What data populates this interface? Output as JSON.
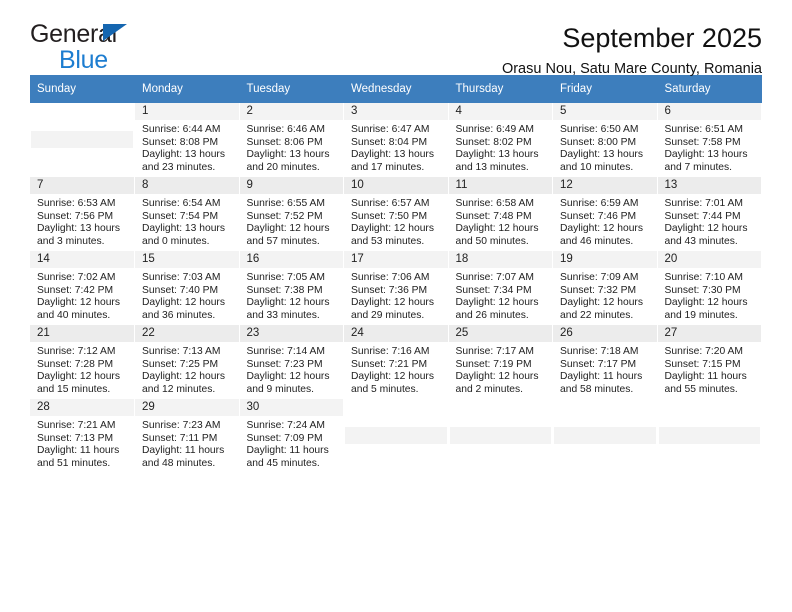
{
  "brand": {
    "name_top": "General",
    "name_bottom": "Blue",
    "accent_color": "#1d7dd0",
    "triangle_color": "#1566b0"
  },
  "header": {
    "title": "September 2025",
    "location": "Orasu Nou, Satu Mare County, Romania"
  },
  "calendar": {
    "header_bg": "#3d7ebd",
    "daynum_bg": "#f3f3f3",
    "daynum_bg_alt": "#ececec",
    "weekday_headers": [
      "Sunday",
      "Monday",
      "Tuesday",
      "Wednesday",
      "Thursday",
      "Friday",
      "Saturday"
    ],
    "labels": {
      "sunrise": "Sunrise:",
      "sunset": "Sunset:",
      "daylight": "Daylight:"
    },
    "weeks": [
      [
        {
          "empty": true
        },
        {
          "day": "1",
          "sunrise": "Sunrise: 6:44 AM",
          "sunset": "Sunset: 8:08 PM",
          "daylight": "Daylight: 13 hours and 23 minutes."
        },
        {
          "day": "2",
          "sunrise": "Sunrise: 6:46 AM",
          "sunset": "Sunset: 8:06 PM",
          "daylight": "Daylight: 13 hours and 20 minutes."
        },
        {
          "day": "3",
          "sunrise": "Sunrise: 6:47 AM",
          "sunset": "Sunset: 8:04 PM",
          "daylight": "Daylight: 13 hours and 17 minutes."
        },
        {
          "day": "4",
          "sunrise": "Sunrise: 6:49 AM",
          "sunset": "Sunset: 8:02 PM",
          "daylight": "Daylight: 13 hours and 13 minutes."
        },
        {
          "day": "5",
          "sunrise": "Sunrise: 6:50 AM",
          "sunset": "Sunset: 8:00 PM",
          "daylight": "Daylight: 13 hours and 10 minutes."
        },
        {
          "day": "6",
          "sunrise": "Sunrise: 6:51 AM",
          "sunset": "Sunset: 7:58 PM",
          "daylight": "Daylight: 13 hours and 7 minutes."
        }
      ],
      [
        {
          "day": "7",
          "sunrise": "Sunrise: 6:53 AM",
          "sunset": "Sunset: 7:56 PM",
          "daylight": "Daylight: 13 hours and 3 minutes."
        },
        {
          "day": "8",
          "sunrise": "Sunrise: 6:54 AM",
          "sunset": "Sunset: 7:54 PM",
          "daylight": "Daylight: 13 hours and 0 minutes."
        },
        {
          "day": "9",
          "sunrise": "Sunrise: 6:55 AM",
          "sunset": "Sunset: 7:52 PM",
          "daylight": "Daylight: 12 hours and 57 minutes."
        },
        {
          "day": "10",
          "sunrise": "Sunrise: 6:57 AM",
          "sunset": "Sunset: 7:50 PM",
          "daylight": "Daylight: 12 hours and 53 minutes."
        },
        {
          "day": "11",
          "sunrise": "Sunrise: 6:58 AM",
          "sunset": "Sunset: 7:48 PM",
          "daylight": "Daylight: 12 hours and 50 minutes."
        },
        {
          "day": "12",
          "sunrise": "Sunrise: 6:59 AM",
          "sunset": "Sunset: 7:46 PM",
          "daylight": "Daylight: 12 hours and 46 minutes."
        },
        {
          "day": "13",
          "sunrise": "Sunrise: 7:01 AM",
          "sunset": "Sunset: 7:44 PM",
          "daylight": "Daylight: 12 hours and 43 minutes."
        }
      ],
      [
        {
          "day": "14",
          "sunrise": "Sunrise: 7:02 AM",
          "sunset": "Sunset: 7:42 PM",
          "daylight": "Daylight: 12 hours and 40 minutes."
        },
        {
          "day": "15",
          "sunrise": "Sunrise: 7:03 AM",
          "sunset": "Sunset: 7:40 PM",
          "daylight": "Daylight: 12 hours and 36 minutes."
        },
        {
          "day": "16",
          "sunrise": "Sunrise: 7:05 AM",
          "sunset": "Sunset: 7:38 PM",
          "daylight": "Daylight: 12 hours and 33 minutes."
        },
        {
          "day": "17",
          "sunrise": "Sunrise: 7:06 AM",
          "sunset": "Sunset: 7:36 PM",
          "daylight": "Daylight: 12 hours and 29 minutes."
        },
        {
          "day": "18",
          "sunrise": "Sunrise: 7:07 AM",
          "sunset": "Sunset: 7:34 PM",
          "daylight": "Daylight: 12 hours and 26 minutes."
        },
        {
          "day": "19",
          "sunrise": "Sunrise: 7:09 AM",
          "sunset": "Sunset: 7:32 PM",
          "daylight": "Daylight: 12 hours and 22 minutes."
        },
        {
          "day": "20",
          "sunrise": "Sunrise: 7:10 AM",
          "sunset": "Sunset: 7:30 PM",
          "daylight": "Daylight: 12 hours and 19 minutes."
        }
      ],
      [
        {
          "day": "21",
          "sunrise": "Sunrise: 7:12 AM",
          "sunset": "Sunset: 7:28 PM",
          "daylight": "Daylight: 12 hours and 15 minutes."
        },
        {
          "day": "22",
          "sunrise": "Sunrise: 7:13 AM",
          "sunset": "Sunset: 7:25 PM",
          "daylight": "Daylight: 12 hours and 12 minutes."
        },
        {
          "day": "23",
          "sunrise": "Sunrise: 7:14 AM",
          "sunset": "Sunset: 7:23 PM",
          "daylight": "Daylight: 12 hours and 9 minutes."
        },
        {
          "day": "24",
          "sunrise": "Sunrise: 7:16 AM",
          "sunset": "Sunset: 7:21 PM",
          "daylight": "Daylight: 12 hours and 5 minutes."
        },
        {
          "day": "25",
          "sunrise": "Sunrise: 7:17 AM",
          "sunset": "Sunset: 7:19 PM",
          "daylight": "Daylight: 12 hours and 2 minutes."
        },
        {
          "day": "26",
          "sunrise": "Sunrise: 7:18 AM",
          "sunset": "Sunset: 7:17 PM",
          "daylight": "Daylight: 11 hours and 58 minutes."
        },
        {
          "day": "27",
          "sunrise": "Sunrise: 7:20 AM",
          "sunset": "Sunset: 7:15 PM",
          "daylight": "Daylight: 11 hours and 55 minutes."
        }
      ],
      [
        {
          "day": "28",
          "sunrise": "Sunrise: 7:21 AM",
          "sunset": "Sunset: 7:13 PM",
          "daylight": "Daylight: 11 hours and 51 minutes."
        },
        {
          "day": "29",
          "sunrise": "Sunrise: 7:23 AM",
          "sunset": "Sunset: 7:11 PM",
          "daylight": "Daylight: 11 hours and 48 minutes."
        },
        {
          "day": "30",
          "sunrise": "Sunrise: 7:24 AM",
          "sunset": "Sunset: 7:09 PM",
          "daylight": "Daylight: 11 hours and 45 minutes."
        },
        {
          "empty": true
        },
        {
          "empty": true
        },
        {
          "empty": true
        },
        {
          "empty": true
        }
      ]
    ]
  }
}
